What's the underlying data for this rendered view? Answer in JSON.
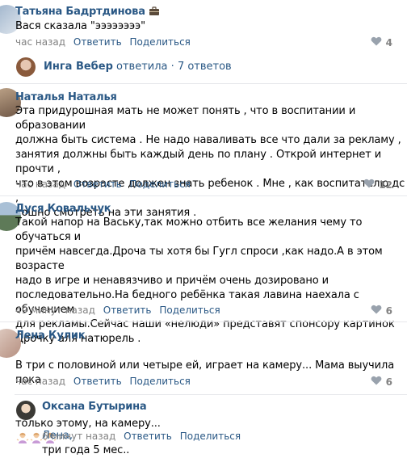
{
  "actions": {
    "reply": "Ответить",
    "share": "Поделиться"
  },
  "colors": {
    "link": "#2a5885",
    "meta": "#828282",
    "divider": "#e7e8ec"
  },
  "comments": [
    {
      "author": "Татьяна Бадртдинова",
      "badge_icon": "briefcase-icon",
      "text": "Вася сказала \"ээээээээ\"",
      "time": "час назад",
      "likes": "4"
    },
    {
      "author": "Наталья Наталья",
      "text": "Эта придурошная мать не может понять , что в воспитании и образовании\nдолжна быть система . Не надо наваливать все что дали за рекламу ,\nзанятия должны быть каждый день по плану . Открой интернет и прочти ,\nчто в этом возрасте должен знать ребенок . Мне , как воспитателю дс ,\nтошно смотреть на эти занятия .",
      "time": "час назад",
      "likes": "12"
    },
    {
      "author": "Дуся Ковальчук",
      "text": "Такой напор на Ваську,так можно отбить все желания чему то обучаться и\nпричём навсегда.Дроча ты хотя бы Гугл спроси ,как надо.А в этом возрасте\nнадо в игре и ненавязчиво и причём очень дозировано и\nпоследовательно.На бедного ребёнка такая лавина наехала с обучением\nдля рекламы.Сейчас наши «нелюди» представят спонсору картинок\nДрочку аля натюрель .",
      "time": "49 минут назад",
      "likes": "6"
    },
    {
      "author": "Лена Кулик",
      "text_line1": "В три с половиной или четыре ей, играет на камеру... Мама выучила пока",
      "text_line2": "только этому, на камеру...",
      "emoji_icon": "woman-shrugging-icon",
      "time": "час назад",
      "likes": "6"
    }
  ],
  "thread_summary": {
    "author": "Инга Вебер",
    "verb": "ответила",
    "separator": "·",
    "count": "7 ответов"
  },
  "reply": {
    "author": "Оксана Бутырина",
    "addressee": "Лена,",
    "text": "три года 5 мес..",
    "time": "6 минут назад"
  }
}
